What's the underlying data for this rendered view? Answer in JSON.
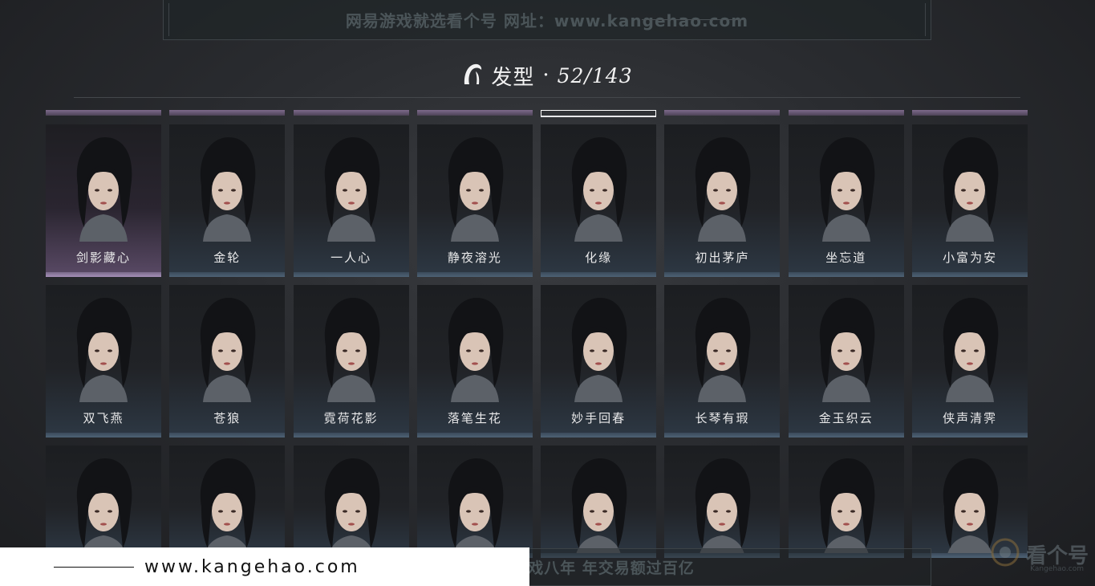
{
  "watermark_top": "网易游戏就选看个号   网址：www.kangehao.com",
  "header": {
    "icon": "hair-icon",
    "label": "发型",
    "separator": "·",
    "count": "52/143"
  },
  "hairstyles": [
    {
      "name": "剑影藏心",
      "rarity": "purple",
      "selected": false
    },
    {
      "name": "金轮",
      "rarity": "blue",
      "selected": false
    },
    {
      "name": "一人心",
      "rarity": "blue",
      "selected": false
    },
    {
      "name": "静夜溶光",
      "rarity": "blue",
      "selected": false
    },
    {
      "name": "化缘",
      "rarity": "blue",
      "selected": true
    },
    {
      "name": "初出茅庐",
      "rarity": "blue",
      "selected": false
    },
    {
      "name": "坐忘道",
      "rarity": "blue",
      "selected": false
    },
    {
      "name": "小富为安",
      "rarity": "blue",
      "selected": false
    },
    {
      "name": "双飞燕",
      "rarity": "blue",
      "selected": false
    },
    {
      "name": "苍狼",
      "rarity": "blue",
      "selected": false
    },
    {
      "name": "霓荷花影",
      "rarity": "blue",
      "selected": false
    },
    {
      "name": "落笔生花",
      "rarity": "blue",
      "selected": false
    },
    {
      "name": "妙手回春",
      "rarity": "blue",
      "selected": false
    },
    {
      "name": "长琴有瑕",
      "rarity": "blue",
      "selected": false
    },
    {
      "name": "金玉织云",
      "rarity": "blue",
      "selected": false
    },
    {
      "name": "侠声清霁",
      "rarity": "blue",
      "selected": false
    },
    {
      "name": "",
      "rarity": "blue",
      "selected": false
    },
    {
      "name": "",
      "rarity": "blue",
      "selected": false
    },
    {
      "name": "",
      "rarity": "blue",
      "selected": false
    },
    {
      "name": "",
      "rarity": "blue",
      "selected": false
    },
    {
      "name": "",
      "rarity": "blue",
      "selected": false
    },
    {
      "name": "",
      "rarity": "blue",
      "selected": false
    },
    {
      "name": "",
      "rarity": "blue",
      "selected": false
    },
    {
      "name": "",
      "rarity": "blue",
      "selected": false
    }
  ],
  "watermark_bottom": "看个号专业网易游戏八年   年交易额过百亿",
  "overlay_url": "www.kangehao.com",
  "corner_logo": {
    "text": "看个号",
    "sub": "Kangehao.com"
  },
  "colors": {
    "purple_rarity": "#a58fb8",
    "blue_rarity": "#4e6275",
    "background": "#2a2c30"
  }
}
